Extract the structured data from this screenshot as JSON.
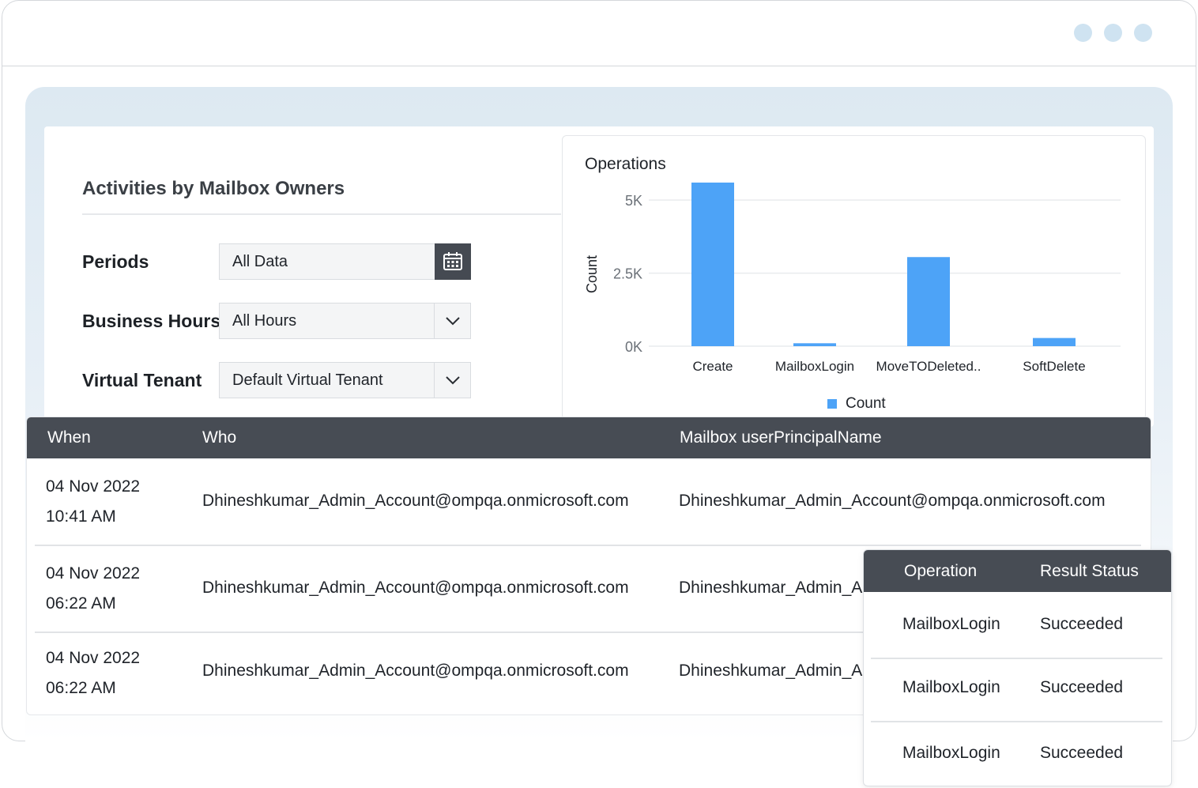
{
  "window": {
    "controls": [
      "dot",
      "dot",
      "dot"
    ],
    "control_color": "#cfe3f1"
  },
  "filters": {
    "title": "Activities by Mailbox Owners",
    "periods": {
      "label": "Periods",
      "value": "All Data",
      "icon": "calendar-icon"
    },
    "business_hours": {
      "label": "Business Hours",
      "value": "All Hours",
      "icon": "chevron-down-icon"
    },
    "virtual_tenant": {
      "label": "Virtual Tenant",
      "value": "Default Virtual Tenant",
      "icon": "chevron-down-icon"
    }
  },
  "chart": {
    "title": "Operations",
    "accent": "#4da3f7"
  },
  "chart_data": {
    "type": "bar",
    "title": "Operations",
    "categories": [
      "Create",
      "MailboxLogin",
      "MoveTODeleted..",
      "SoftDelete"
    ],
    "series": [
      {
        "name": "Count",
        "values": [
          5600,
          100,
          3050,
          280
        ]
      }
    ],
    "ylabel": "Count",
    "xlabel": "",
    "yticks": [
      "0K",
      "2.5K",
      "5K"
    ],
    "ytick_values": [
      0,
      2500,
      5000
    ],
    "ylim": [
      0,
      5600
    ],
    "grid": true,
    "legend": "bottom-center",
    "legend_label": "Count"
  },
  "table": {
    "columns": [
      "When",
      "Who",
      "Mailbox userPrincipalName"
    ],
    "rows": [
      {
        "date": "04 Nov 2022",
        "time": "10:41 AM",
        "who": "Dhineshkumar_Admin_Account@ompqa.onmicrosoft.com",
        "mailbox": "Dhineshkumar_Admin_Account@ompqa.onmicrosoft.com"
      },
      {
        "date": "04 Nov 2022",
        "time": "06:22 AM",
        "who": "Dhineshkumar_Admin_Account@ompqa.onmicrosoft.com",
        "mailbox": "Dhineshkumar_Admin_A"
      },
      {
        "date": "04 Nov 2022",
        "time": "06:22 AM",
        "who": "Dhineshkumar_Admin_Account@ompqa.onmicrosoft.com",
        "mailbox": "Dhineshkumar_Admin_A"
      }
    ]
  },
  "popup": {
    "columns": [
      "Operation",
      "Result Status"
    ],
    "rows": [
      {
        "operation": "MailboxLogin",
        "status": "Succeeded"
      },
      {
        "operation": "MailboxLogin",
        "status": "Succeeded"
      },
      {
        "operation": "MailboxLogin",
        "status": "Succeeded"
      }
    ]
  }
}
